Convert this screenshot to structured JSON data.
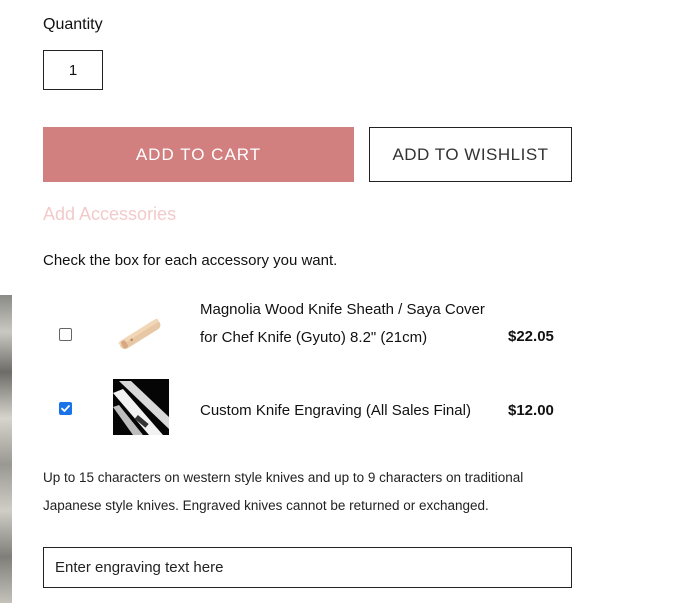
{
  "quantity": {
    "label": "Quantity",
    "value": "1"
  },
  "buttons": {
    "add_to_cart": "ADD TO CART",
    "add_to_wishlist": "ADD TO WISHLIST"
  },
  "accessories": {
    "heading": "Add Accessories",
    "instructions": "Check the box for each accessory you want.",
    "items": [
      {
        "name": "Magnolia Wood Knife Sheath / Saya Cover for Chef Knife (Gyuto) 8.2\" (21cm)",
        "price": "$22.05",
        "checked": false,
        "thumbnail_icon": "wood-sheath-image"
      },
      {
        "name": "Custom Knife Engraving (All Sales Final)",
        "price": "$12.00",
        "checked": true,
        "thumbnail_icon": "engraved-knife-image"
      }
    ]
  },
  "engraving": {
    "note": "Up to 15 characters on western style knives and up to 9 characters on traditional Japanese style knives. Engraved knives cannot be returned or exchanged.",
    "placeholder": "Enter engraving text here"
  },
  "colors": {
    "cart_button": "#d27f80",
    "accessories_heading": "#f3caca",
    "checkbox_checked": "#1a73e8"
  }
}
